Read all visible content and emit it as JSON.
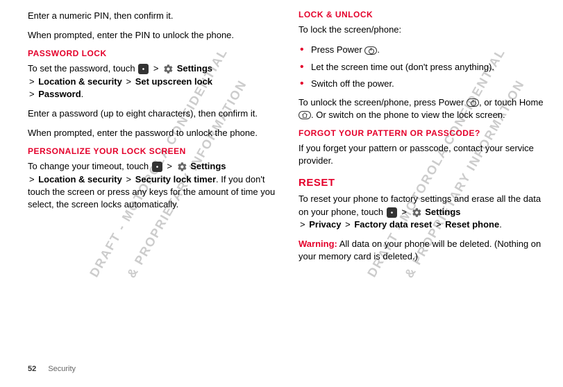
{
  "col1": {
    "p1": "Enter a numeric PIN, then confirm it.",
    "p2": "When prompted, enter the PIN to unlock the phone.",
    "h1": "PASSWORD LOCK",
    "p3a": "To set the password, touch ",
    "p3b": "Settings",
    "p3c": "Location & security",
    "p3d": "Set upscreen lock",
    "p3e": "Password",
    "p3f": ".",
    "p4": "Enter a password (up to eight characters), then confirm it.",
    "p5": "When prompted, enter the password to unlock the phone.",
    "h2": "PERSONALIZE YOUR LOCK SCREEN",
    "p6a": "To change your timeout, touch ",
    "p6b": "Settings",
    "p6c": "Location & security",
    "p6d": "Security lock timer",
    "p6e": ". If you don't touch the screen or press any keys for the amount of time you select, the screen locks automatically."
  },
  "col2": {
    "h1": "LOCK & UNLOCK",
    "p1": "To lock the screen/phone:",
    "li1a": "Press Power ",
    "li1b": ".",
    "li2": "Let the screen time out (don't press anything).",
    "li3": "Switch off the power.",
    "p2a": "To unlock the screen/phone, press Power ",
    "p2b": ", or touch Home ",
    "p2c": ". Or switch on the phone to view the lock screen.",
    "h2": "FORGOT YOUR PATTERN OR PASSCODE?",
    "p3": "If you forget your pattern or passcode, contact your service provider.",
    "h3": "RESET",
    "p4a": "To reset your phone to factory settings and erase all the data on your phone, touch ",
    "p4b": "Settings",
    "p4c": "Privacy",
    "p4d": "Factory data reset",
    "p4e": "Reset phone",
    "p4f": ".",
    "p5a": "Warning:",
    "p5b": " All data on your phone will be deleted. (Nothing on your memory card is deleted.)"
  },
  "footer": {
    "page": "52",
    "section": "Security"
  },
  "watermark_line1": "DRAFT - MOTOROLA CONFIDENTIAL",
  "watermark_line2": "& PROPRIETARY INFORMATION",
  "gt": ">"
}
